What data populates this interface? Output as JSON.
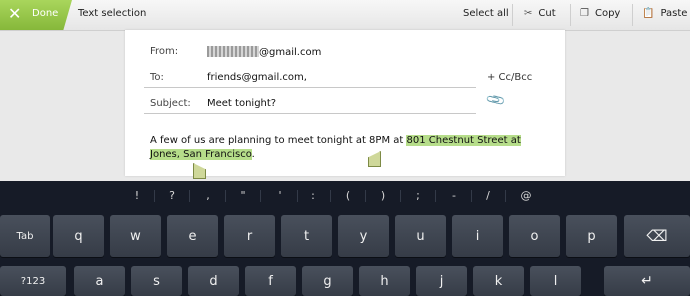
{
  "action_bar": {
    "done_label": "Done",
    "title": "Text selection",
    "select_all": "Select all",
    "cut": "Cut",
    "copy": "Copy",
    "paste": "Paste"
  },
  "compose": {
    "from_label": "From:",
    "from_value_suffix": "@gmail.com",
    "to_label": "To:",
    "to_value": "friends@gmail.com,",
    "ccbcc": "+ Cc/Bcc",
    "subject_label": "Subject:",
    "subject_value": "Meet tonight?",
    "body_plain": "A few of us are planning to meet tonight at 8PM at ",
    "body_selected": "801 Chestnut Street at Jones, San Francisco",
    "body_after": "."
  },
  "keyboard": {
    "symbols": [
      "!",
      "?",
      ",",
      "\"",
      "'",
      ":",
      "(",
      ")",
      ";",
      "-",
      "/",
      "@"
    ],
    "row1": [
      "Tab",
      "q",
      "w",
      "e",
      "r",
      "t",
      "y",
      "u",
      "i",
      "o",
      "p"
    ],
    "row2": [
      "?123",
      "a",
      "s",
      "d",
      "f",
      "g",
      "h",
      "j",
      "k",
      "l"
    ]
  },
  "colors": {
    "accent_green": "#86b83a",
    "selection": "#b6dd8a",
    "keyboard_bg": "#161b27"
  }
}
